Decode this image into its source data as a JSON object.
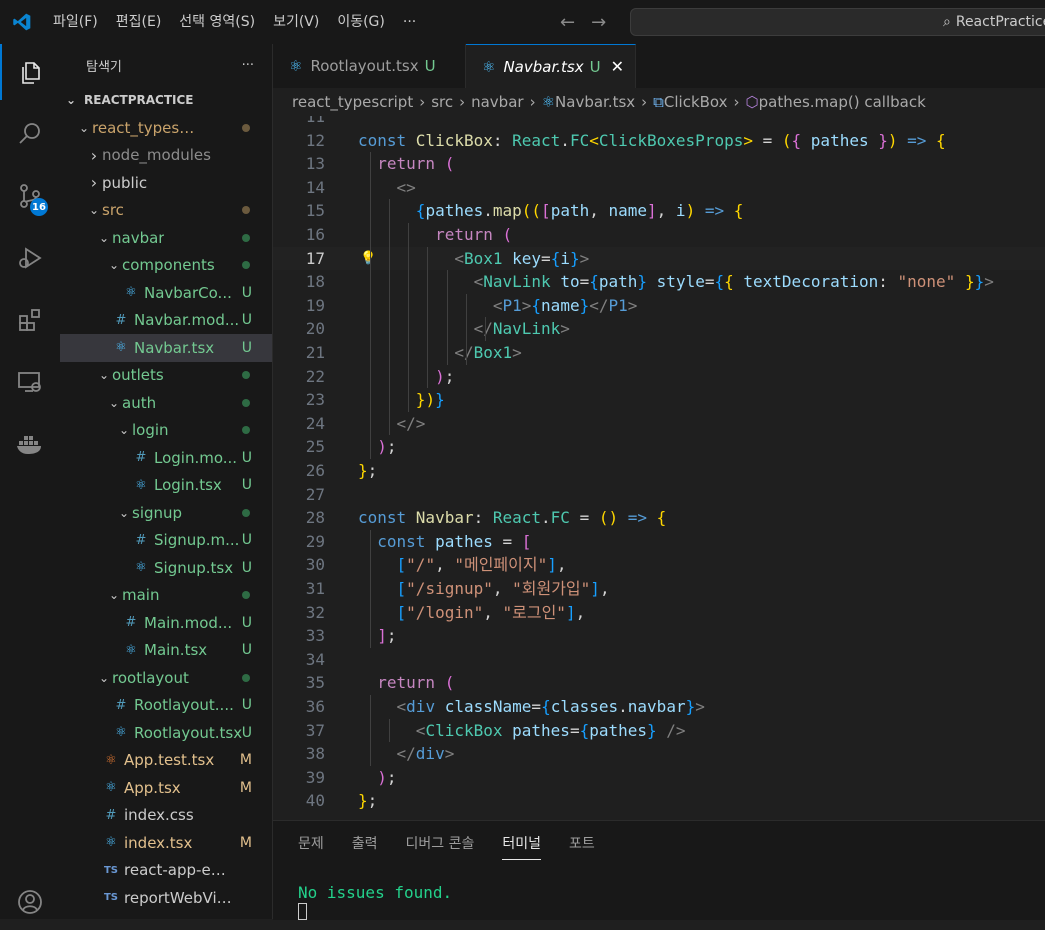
{
  "titlebar": {
    "menu": [
      "파일(F)",
      "편집(E)",
      "선택 영역(S)",
      "보기(V)",
      "이동(G)",
      "···"
    ],
    "search_text": "ReactPractice"
  },
  "activitybar": {
    "scm_badge": "16"
  },
  "sidebar": {
    "title": "탐색기",
    "more": "···",
    "root": "REACTPRACTICE",
    "tree": [
      {
        "label": "react_typescript",
        "depth": 1,
        "kind": "folder",
        "open": true,
        "status": "dot-mod"
      },
      {
        "label": "node_modules",
        "depth": 2,
        "kind": "folder",
        "open": false,
        "status": "",
        "dim": true
      },
      {
        "label": "public",
        "depth": 2,
        "kind": "folder",
        "open": false,
        "status": ""
      },
      {
        "label": "src",
        "depth": 2,
        "kind": "folder",
        "open": true,
        "status": "dot-mod"
      },
      {
        "label": "navbar",
        "depth": 3,
        "kind": "folder",
        "open": true,
        "status": "dot-u"
      },
      {
        "label": "components",
        "depth": 4,
        "kind": "folder",
        "open": true,
        "status": "dot-u"
      },
      {
        "label": "NavbarCo...",
        "depth": 5,
        "kind": "react",
        "status": "U"
      },
      {
        "label": "Navbar.mod...",
        "depth": 4,
        "kind": "css",
        "status": "U"
      },
      {
        "label": "Navbar.tsx",
        "depth": 4,
        "kind": "react",
        "status": "U",
        "selected": true
      },
      {
        "label": "outlets",
        "depth": 3,
        "kind": "folder",
        "open": true,
        "status": "dot-u"
      },
      {
        "label": "auth",
        "depth": 4,
        "kind": "folder",
        "open": true,
        "status": "dot-u"
      },
      {
        "label": "login",
        "depth": 5,
        "kind": "folder",
        "open": true,
        "status": "dot-u"
      },
      {
        "label": "Login.mo...",
        "depth": 6,
        "kind": "css",
        "status": "U"
      },
      {
        "label": "Login.tsx",
        "depth": 6,
        "kind": "react",
        "status": "U"
      },
      {
        "label": "signup",
        "depth": 5,
        "kind": "folder",
        "open": true,
        "status": "dot-u"
      },
      {
        "label": "Signup.m...",
        "depth": 6,
        "kind": "css",
        "status": "U"
      },
      {
        "label": "Signup.tsx",
        "depth": 6,
        "kind": "react",
        "status": "U"
      },
      {
        "label": "main",
        "depth": 4,
        "kind": "folder",
        "open": true,
        "status": "dot-u"
      },
      {
        "label": "Main.mod...",
        "depth": 5,
        "kind": "css",
        "status": "U"
      },
      {
        "label": "Main.tsx",
        "depth": 5,
        "kind": "react",
        "status": "U"
      },
      {
        "label": "rootlayout",
        "depth": 3,
        "kind": "folder",
        "open": true,
        "status": "dot-u"
      },
      {
        "label": "Rootlayout....",
        "depth": 4,
        "kind": "css",
        "status": "U"
      },
      {
        "label": "Rootlayout.tsx",
        "depth": 4,
        "kind": "react",
        "status": "U"
      },
      {
        "label": "App.test.tsx",
        "depth": 3,
        "kind": "test",
        "status": "M"
      },
      {
        "label": "App.tsx",
        "depth": 3,
        "kind": "react",
        "status": "M"
      },
      {
        "label": "index.css",
        "depth": 3,
        "kind": "css",
        "status": ""
      },
      {
        "label": "index.tsx",
        "depth": 3,
        "kind": "react",
        "status": "M"
      },
      {
        "label": "react-app-env.d.ts",
        "depth": 3,
        "kind": "ts",
        "status": ""
      },
      {
        "label": "reportWebVitals.ts",
        "depth": 3,
        "kind": "ts",
        "status": ""
      }
    ]
  },
  "tabs": [
    {
      "label": "Rootlayout.tsx",
      "status": "U",
      "active": false
    },
    {
      "label": "Navbar.tsx",
      "status": "U",
      "active": true
    }
  ],
  "breadcrumb": [
    "react_typescript",
    "src",
    "navbar",
    "Navbar.tsx",
    "ClickBox",
    "pathes.map() callback"
  ],
  "code": {
    "first_line": 11,
    "current_line": 17,
    "lines": [
      [],
      [
        [
          "k",
          "const "
        ],
        [
          "f",
          "ClickBox"
        ],
        [
          "p",
          ": "
        ],
        [
          "t",
          "React"
        ],
        [
          "p",
          "."
        ],
        [
          "t",
          "FC"
        ],
        [
          "b1",
          "<"
        ],
        [
          "t",
          "ClickBoxesProps"
        ],
        [
          "b1",
          ">"
        ],
        [
          "p",
          " = "
        ],
        [
          "b1",
          "("
        ],
        [
          "b2",
          "{ "
        ],
        [
          "v",
          "pathes"
        ],
        [
          "b2",
          " }"
        ],
        [
          "b1",
          ")"
        ],
        [
          "k",
          " => "
        ],
        [
          "b1",
          "{"
        ]
      ],
      [
        [
          "p",
          "  "
        ],
        [
          "c",
          "return "
        ],
        [
          "b2",
          "("
        ]
      ],
      [
        [
          "p",
          "    "
        ],
        [
          "g",
          "<>"
        ]
      ],
      [
        [
          "p",
          "      "
        ],
        [
          "b3",
          "{"
        ],
        [
          "v",
          "pathes"
        ],
        [
          "p",
          "."
        ],
        [
          "f",
          "map"
        ],
        [
          "b1",
          "(("
        ],
        [
          "b2",
          "["
        ],
        [
          "v",
          "path"
        ],
        [
          "p",
          ", "
        ],
        [
          "v",
          "name"
        ],
        [
          "b2",
          "]"
        ],
        [
          "p",
          ", "
        ],
        [
          "v",
          "i"
        ],
        [
          "b1",
          ")"
        ],
        [
          "k",
          " => "
        ],
        [
          "b1",
          "{"
        ]
      ],
      [
        [
          "p",
          "        "
        ],
        [
          "c",
          "return "
        ],
        [
          "b2",
          "("
        ]
      ],
      [
        [
          "p",
          "          "
        ],
        [
          "g",
          "<"
        ],
        [
          "t",
          "Box1"
        ],
        [
          "p",
          " "
        ],
        [
          "v",
          "key"
        ],
        [
          "p",
          "="
        ],
        [
          "b3",
          "{"
        ],
        [
          "v",
          "i"
        ],
        [
          "b3",
          "}"
        ],
        [
          "g",
          ">"
        ]
      ],
      [
        [
          "p",
          "            "
        ],
        [
          "g",
          "<"
        ],
        [
          "t",
          "NavLink"
        ],
        [
          "p",
          " "
        ],
        [
          "v",
          "to"
        ],
        [
          "p",
          "="
        ],
        [
          "b3",
          "{"
        ],
        [
          "v",
          "path"
        ],
        [
          "b3",
          "}"
        ],
        [
          "p",
          " "
        ],
        [
          "v",
          "style"
        ],
        [
          "p",
          "="
        ],
        [
          "b3",
          "{"
        ],
        [
          "b1",
          "{ "
        ],
        [
          "v",
          "textDecoration"
        ],
        [
          "p",
          ": "
        ],
        [
          "s",
          "\"none\""
        ],
        [
          "b1",
          " }"
        ],
        [
          "b3",
          "}"
        ],
        [
          "g",
          ">"
        ]
      ],
      [
        [
          "p",
          "              "
        ],
        [
          "g",
          "<"
        ],
        [
          "k",
          "P1"
        ],
        [
          "g",
          ">"
        ],
        [
          "b3",
          "{"
        ],
        [
          "v",
          "name"
        ],
        [
          "b3",
          "}"
        ],
        [
          "g",
          "</"
        ],
        [
          "k",
          "P1"
        ],
        [
          "g",
          ">"
        ]
      ],
      [
        [
          "p",
          "            "
        ],
        [
          "g",
          "</"
        ],
        [
          "t",
          "NavLink"
        ],
        [
          "g",
          ">"
        ]
      ],
      [
        [
          "p",
          "          "
        ],
        [
          "g",
          "</"
        ],
        [
          "t",
          "Box1"
        ],
        [
          "g",
          ">"
        ]
      ],
      [
        [
          "p",
          "        "
        ],
        [
          "b2",
          ")"
        ],
        [
          "p",
          ";"
        ]
      ],
      [
        [
          "p",
          "      "
        ],
        [
          "b1",
          "}"
        ],
        [
          "b1",
          ")"
        ],
        [
          "b3",
          "}"
        ]
      ],
      [
        [
          "p",
          "    "
        ],
        [
          "g",
          "</>"
        ]
      ],
      [
        [
          "p",
          "  "
        ],
        [
          "b2",
          ")"
        ],
        [
          "p",
          ";"
        ]
      ],
      [
        [
          "b1",
          "}"
        ],
        [
          "p",
          ";"
        ]
      ],
      [],
      [
        [
          "k",
          "const "
        ],
        [
          "f",
          "Navbar"
        ],
        [
          "p",
          ": "
        ],
        [
          "t",
          "React"
        ],
        [
          "p",
          "."
        ],
        [
          "t",
          "FC"
        ],
        [
          "p",
          " = "
        ],
        [
          "b1",
          "("
        ],
        [
          "b1",
          ")"
        ],
        [
          "k",
          " => "
        ],
        [
          "b1",
          "{"
        ]
      ],
      [
        [
          "p",
          "  "
        ],
        [
          "k",
          "const "
        ],
        [
          "v",
          "pathes"
        ],
        [
          "p",
          " = "
        ],
        [
          "b2",
          "["
        ]
      ],
      [
        [
          "p",
          "    "
        ],
        [
          "b3",
          "["
        ],
        [
          "s",
          "\"/\""
        ],
        [
          "p",
          ", "
        ],
        [
          "s",
          "\"메인페이지\""
        ],
        [
          "b3",
          "]"
        ],
        [
          "p",
          ","
        ]
      ],
      [
        [
          "p",
          "    "
        ],
        [
          "b3",
          "["
        ],
        [
          "s",
          "\"/signup\""
        ],
        [
          "p",
          ", "
        ],
        [
          "s",
          "\"회원가입\""
        ],
        [
          "b3",
          "]"
        ],
        [
          "p",
          ","
        ]
      ],
      [
        [
          "p",
          "    "
        ],
        [
          "b3",
          "["
        ],
        [
          "s",
          "\"/login\""
        ],
        [
          "p",
          ", "
        ],
        [
          "s",
          "\"로그인\""
        ],
        [
          "b3",
          "]"
        ],
        [
          "p",
          ","
        ]
      ],
      [
        [
          "p",
          "  "
        ],
        [
          "b2",
          "]"
        ],
        [
          "p",
          ";"
        ]
      ],
      [],
      [
        [
          "p",
          "  "
        ],
        [
          "c",
          "return "
        ],
        [
          "b2",
          "("
        ]
      ],
      [
        [
          "p",
          "    "
        ],
        [
          "g",
          "<"
        ],
        [
          "k",
          "div"
        ],
        [
          "p",
          " "
        ],
        [
          "v",
          "className"
        ],
        [
          "p",
          "="
        ],
        [
          "b3",
          "{"
        ],
        [
          "v",
          "classes"
        ],
        [
          "p",
          "."
        ],
        [
          "v",
          "navbar"
        ],
        [
          "b3",
          "}"
        ],
        [
          "g",
          ">"
        ]
      ],
      [
        [
          "p",
          "      "
        ],
        [
          "g",
          "<"
        ],
        [
          "t",
          "ClickBox"
        ],
        [
          "p",
          " "
        ],
        [
          "v",
          "pathes"
        ],
        [
          "p",
          "="
        ],
        [
          "b3",
          "{"
        ],
        [
          "v",
          "pathes"
        ],
        [
          "b3",
          "}"
        ],
        [
          "g",
          " />"
        ]
      ],
      [
        [
          "p",
          "    "
        ],
        [
          "g",
          "</"
        ],
        [
          "k",
          "div"
        ],
        [
          "g",
          ">"
        ]
      ],
      [
        [
          "p",
          "  "
        ],
        [
          "b2",
          ")"
        ],
        [
          "p",
          ";"
        ]
      ],
      [
        [
          "b1",
          "}"
        ],
        [
          "p",
          ";"
        ]
      ]
    ]
  },
  "panel": {
    "tabs": [
      "문제",
      "출력",
      "디버그 콘솔",
      "터미널",
      "포트"
    ],
    "active_tab": 3,
    "terminal_output": "No issues found."
  }
}
